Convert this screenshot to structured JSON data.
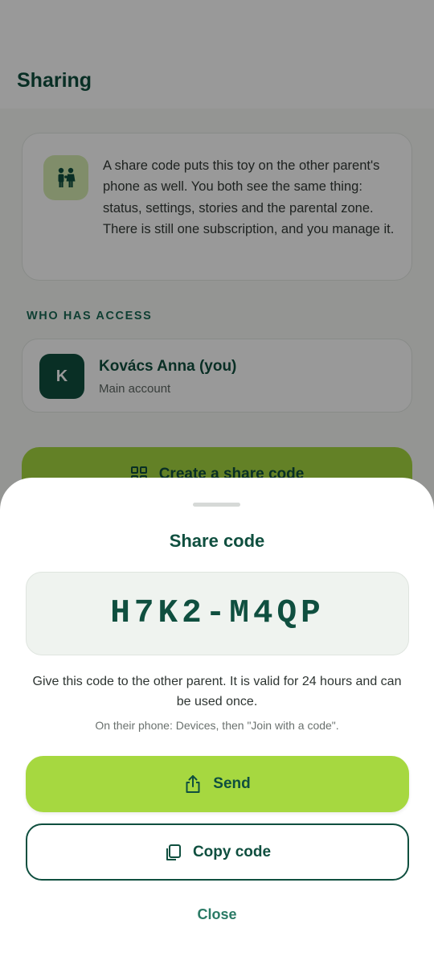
{
  "header": {
    "title": "Sharing"
  },
  "info_card": {
    "icon": "family-icon",
    "text": "A share code puts this toy on the other parent's phone as well. You both see the same thing: status, settings, stories and the parental zone. There is still one subscription, and you manage it."
  },
  "access_section": {
    "label": "WHO HAS ACCESS",
    "members": [
      {
        "initial": "K",
        "name": "Kovács Anna (you)",
        "role": "Main account"
      }
    ]
  },
  "create_button": {
    "label": "Create a share code",
    "icon": "qr-grid-icon"
  },
  "sheet": {
    "title": "Share code",
    "code": "H7K2-M4QP",
    "description": "Give this code to the other parent. It is valid for 24 hours and can be used once.",
    "hint": "On their phone: Devices, then \"Join with a code\".",
    "send_label": "Send",
    "copy_label": "Copy code",
    "close_label": "Close"
  },
  "colors": {
    "primary_dark": "#0f4f3f",
    "accent_green": "#a6d840",
    "icon_bg": "#d5ecb1",
    "link": "#2a7a65"
  }
}
